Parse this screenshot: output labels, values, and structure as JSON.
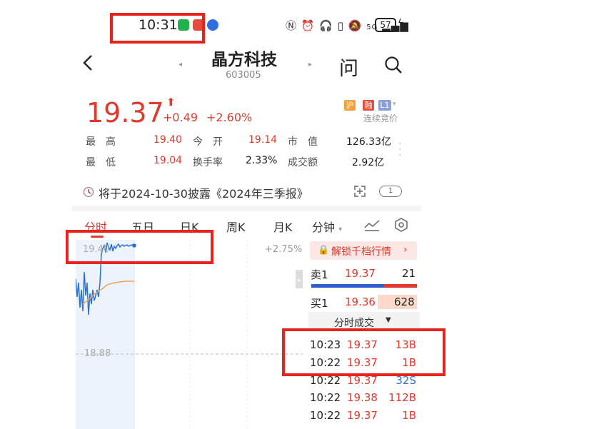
{
  "status_bar": {
    "time": "10:31",
    "right_icons": [
      "nfc-icon",
      "alarm-icon",
      "headphones-icon",
      "vibrate-icon",
      "mute-icon",
      "5g-icon",
      "signal-icon"
    ],
    "network": "5G",
    "battery": "57"
  },
  "header": {
    "back_icon": "back-chevron-icon",
    "title": "晶方科技",
    "code": "603005",
    "ask_label": "问",
    "search_icon": "search-icon"
  },
  "quote": {
    "price": "19.37",
    "change": "+0.49",
    "change_pct": "+2.60%",
    "badges": [
      "沪",
      "融",
      "L1"
    ],
    "session": "连续竞价",
    "stats": [
      {
        "label": "最　高",
        "value": "19.40"
      },
      {
        "label": "今　开",
        "value": "19.14"
      },
      {
        "label": "市　值",
        "value": "126.33亿"
      },
      {
        "label": "最　低",
        "value": "19.04"
      },
      {
        "label": "换手率",
        "value": "2.33%"
      },
      {
        "label": "成交额",
        "value": "2.92亿"
      }
    ]
  },
  "disclosure": "将于2024-10-30披露《2024年三季报》",
  "tabs": [
    "分时",
    "五日",
    "日K",
    "周K",
    "月K",
    "分钟"
  ],
  "chart": {
    "top_price": "19.40",
    "top_pct": "+2.75%",
    "ref_price": "18.88"
  },
  "orderbook": {
    "unlock_label": "解锁千档行情",
    "sell": {
      "label": "卖1",
      "price": "19.37",
      "volume": "21"
    },
    "buy": {
      "label": "买1",
      "price": "19.36",
      "volume": "628"
    },
    "trades_title": "分时成交"
  },
  "trades": [
    {
      "time": "10:23",
      "price": "19.37",
      "volume": "13B"
    },
    {
      "time": "10:22",
      "price": "19.37",
      "volume": "1B"
    },
    {
      "time": "10:22",
      "price": "19.37",
      "volume": "32S"
    },
    {
      "time": "10:22",
      "price": "19.38",
      "volume": "112B"
    },
    {
      "time": "10:22",
      "price": "19.37",
      "volume": "1B"
    }
  ],
  "colors": {
    "up": "#e0392b",
    "down": "#1e8e3e",
    "price_line": "#2a6fd6",
    "avg_line": "#f0a05a",
    "annotation": "#e8221c"
  }
}
